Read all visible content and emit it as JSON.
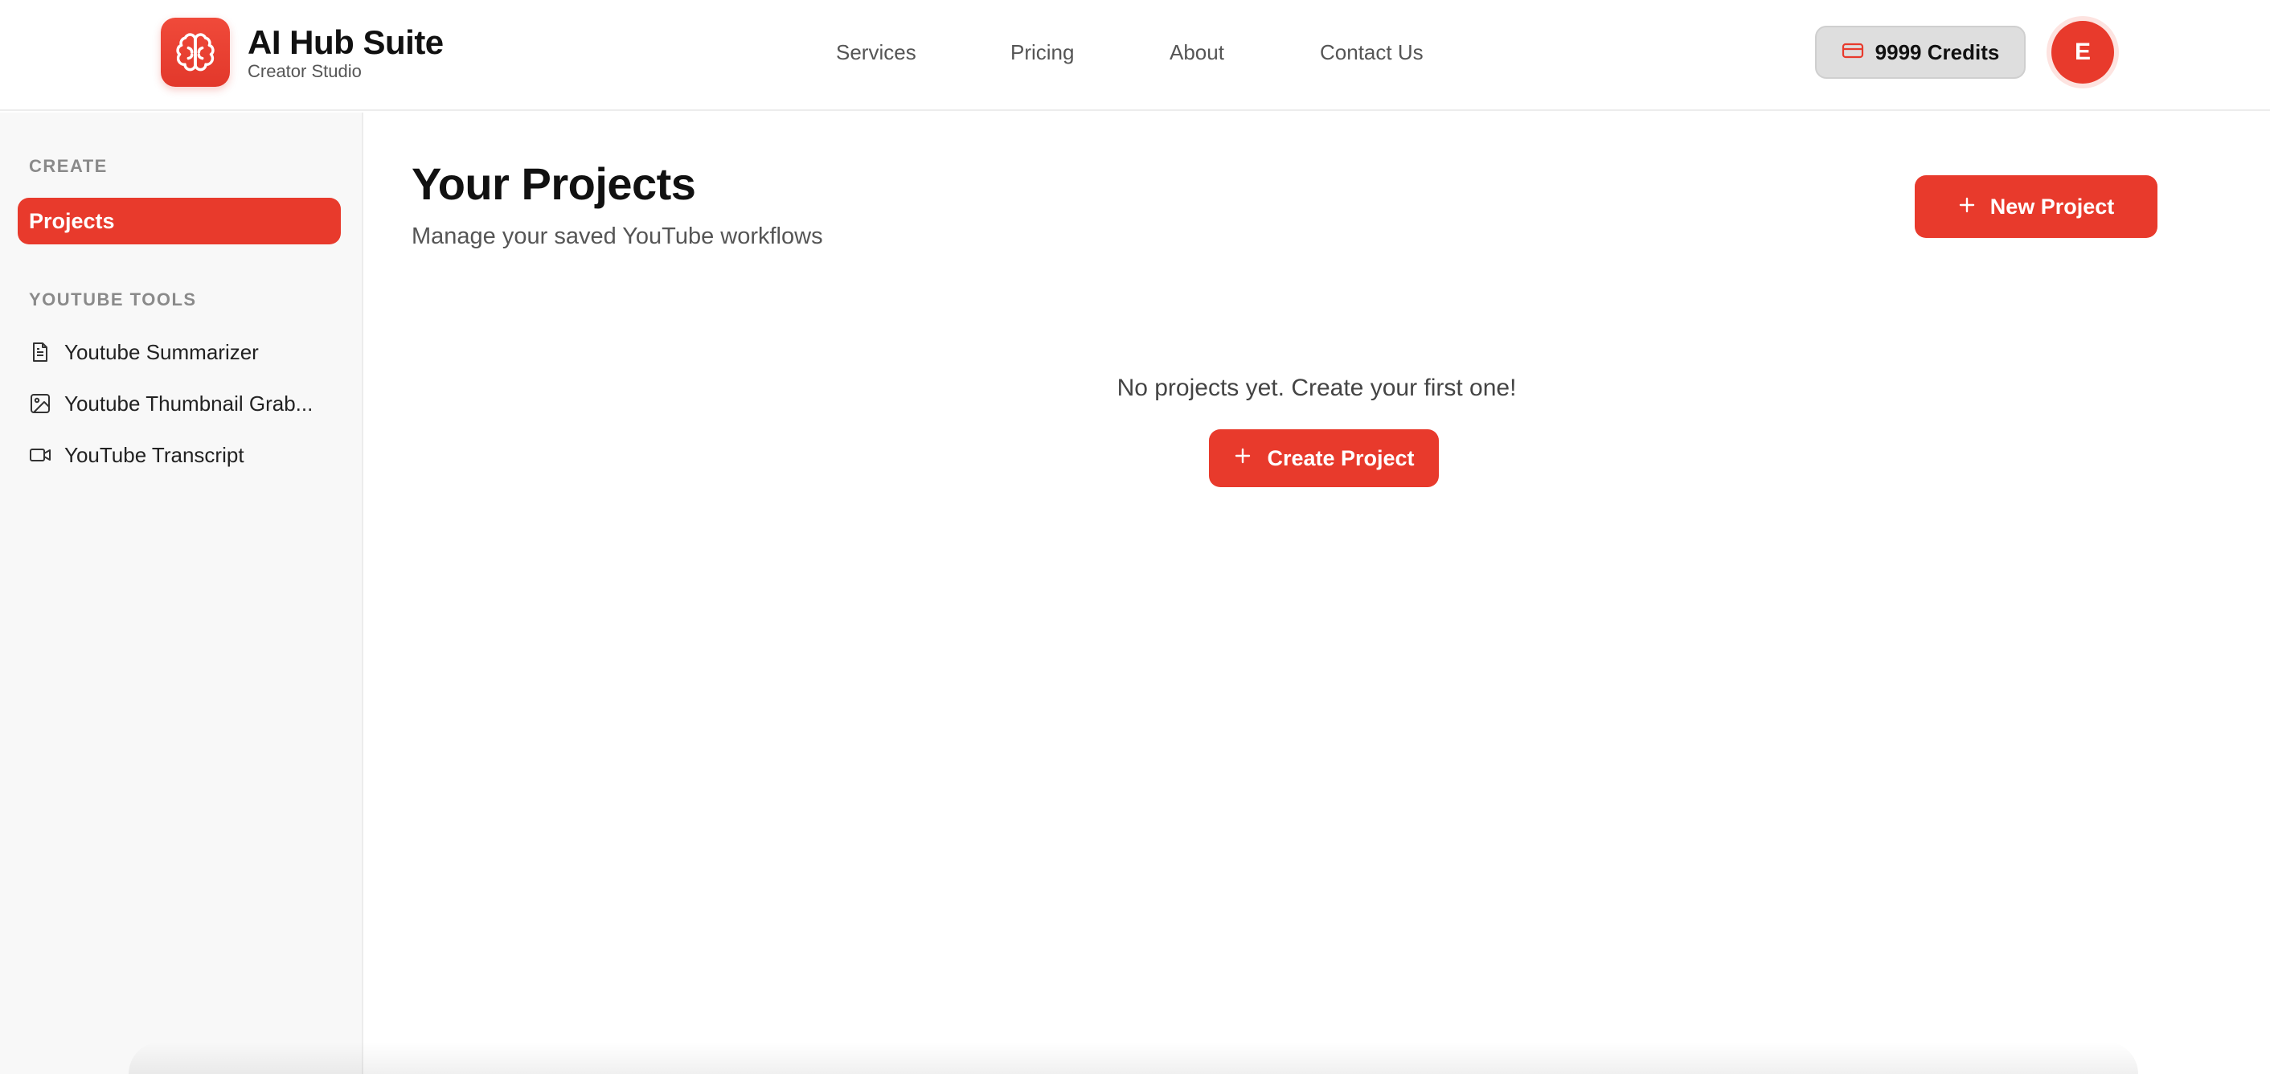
{
  "brand": {
    "title": "AI Hub Suite",
    "subtitle": "Creator Studio",
    "logo_icon": "brain-icon"
  },
  "nav": {
    "items": [
      "Services",
      "Pricing",
      "About",
      "Contact Us"
    ]
  },
  "credits": {
    "label": "9999 Credits",
    "icon": "credit-card-icon"
  },
  "user": {
    "avatar_initial": "E"
  },
  "sidebar": {
    "section_create": "CREATE",
    "projects_label": "Projects",
    "section_tools": "YOUTUBE TOOLS",
    "tools": [
      {
        "label": "Youtube Summarizer",
        "icon": "document-icon"
      },
      {
        "label": "Youtube Thumbnail Grab...",
        "icon": "image-icon"
      },
      {
        "label": "YouTube Transcript",
        "icon": "video-icon"
      }
    ]
  },
  "main": {
    "title": "Your Projects",
    "subtitle": "Manage your saved YouTube workflows",
    "new_project_label": "New Project",
    "empty_message": "No projects yet. Create your first one!",
    "create_project_label": "Create Project"
  },
  "colors": {
    "accent": "#e83a2c",
    "sidebar_bg": "#f8f8f8",
    "credits_bg": "#dedede"
  }
}
